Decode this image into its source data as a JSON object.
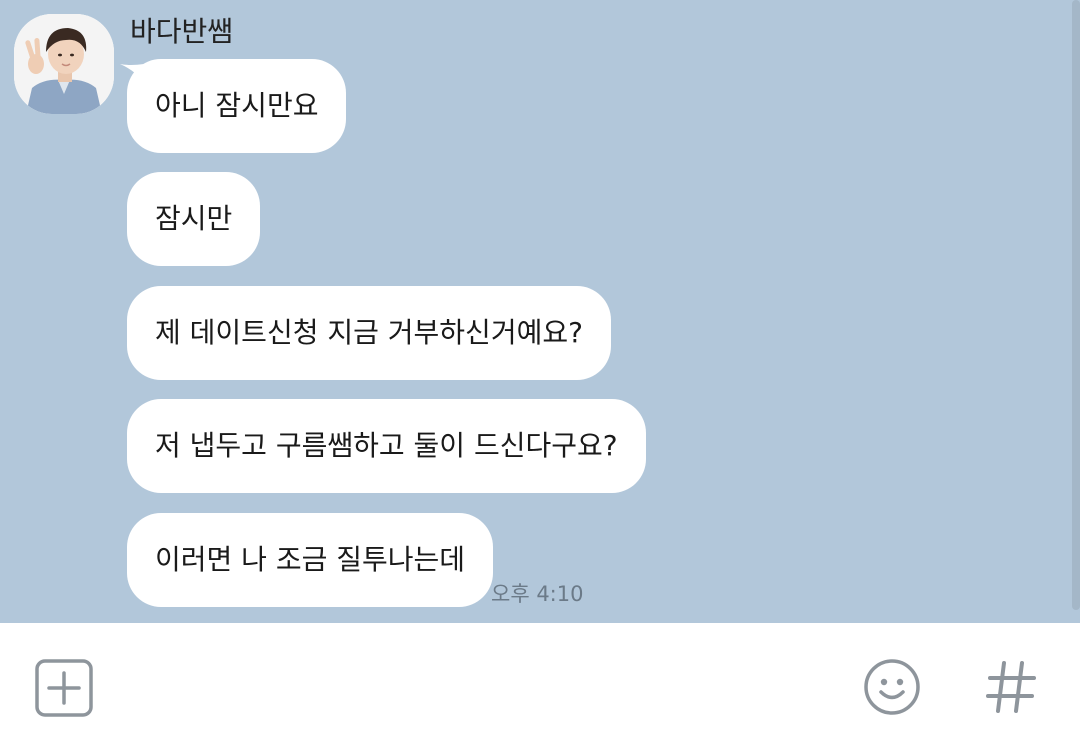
{
  "chat": {
    "sender_name": "바다반쌤",
    "messages": [
      "아니 잠시만요",
      "잠시만",
      "제 데이트신청 지금 거부하신거예요?",
      "저 냅두고 구름쌤하고 둘이 드신다구요?",
      "이러면 나 조금 질투나는데"
    ],
    "timestamp": "오후 4:10"
  },
  "input_bar": {
    "left_icon": "add-icon",
    "right_icons": [
      "emoji-icon",
      "hashtag-icon"
    ]
  },
  "colors": {
    "chat_background": "#b2c7da",
    "bubble": "#ffffff",
    "icon_gray": "#8e959c"
  }
}
